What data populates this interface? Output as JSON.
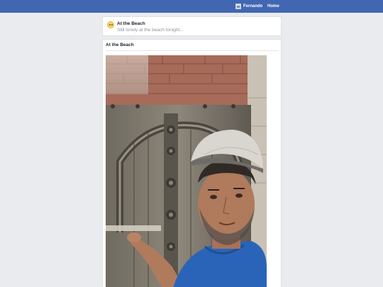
{
  "topbar": {
    "profile_name": "Fernando",
    "home_label": "Home",
    "color": "#4267b2"
  },
  "status": {
    "title": "At the Beach",
    "text": "Still lonely at the beach tonight...",
    "icon": "smiley-face-icon"
  },
  "post": {
    "title": "At the Beach",
    "photo_description": "man-in-cap-selfie-by-carved-wooden-door"
  }
}
